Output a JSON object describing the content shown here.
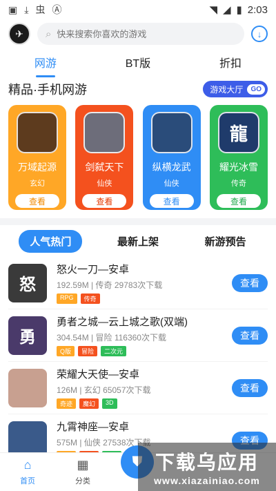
{
  "status": {
    "time": "2:03",
    "left_icons": [
      "image-icon",
      "download-arrow-icon",
      "app-icon",
      "a-icon"
    ]
  },
  "header": {
    "search_placeholder": "快来搜索你喜欢的游戏"
  },
  "tabs": [
    {
      "label": "网游",
      "active": true
    },
    {
      "label": "BT版",
      "active": false
    },
    {
      "label": "折扣",
      "active": false
    }
  ],
  "featured": {
    "title": "精品·手机网游",
    "hall_button": "游戏大厅",
    "hall_go": "GO",
    "cards": [
      {
        "name": "万域起源",
        "genre": "玄幻",
        "button": "查看",
        "bg": "#ffa726",
        "img": "#5d3b1e",
        "img_text": "",
        "btn_color": "#f08a00"
      },
      {
        "name": "剑弑天下",
        "genre": "仙侠",
        "button": "查看",
        "bg": "#f4511e",
        "img": "#6d6d7a",
        "img_text": "",
        "btn_color": "#e53900"
      },
      {
        "name": "纵横龙武",
        "genre": "仙侠",
        "button": "查看",
        "bg": "#2f8df5",
        "img": "#2a4c7a",
        "img_text": "",
        "btn_color": "#2f8df5"
      },
      {
        "name": "耀光冰雪",
        "genre": "传奇",
        "button": "查看",
        "bg": "#2ebd59",
        "img": "#1f3b6b",
        "img_text": "龍",
        "btn_color": "#1ea84a"
      }
    ]
  },
  "subtabs": [
    {
      "label": "人气热门",
      "active": true
    },
    {
      "label": "最新上架",
      "active": false
    },
    {
      "label": "新游预告",
      "active": false
    }
  ],
  "games": [
    {
      "name": "怒火一刀—安卓",
      "meta": "192.59M | 传奇   29783次下载",
      "img": "#3a3a3a",
      "img_text": "怒",
      "button": "查看",
      "tags": [
        {
          "label": "RPG",
          "color": "#ffa726"
        },
        {
          "label": "传奇",
          "color": "#f4511e"
        }
      ]
    },
    {
      "name": "勇者之城—云上城之歌(双端)",
      "meta": "304.54M | 冒险   116360次下载",
      "img": "#4a3a6a",
      "img_text": "勇",
      "button": "查看",
      "tags": [
        {
          "label": "Q版",
          "color": "#ffa726"
        },
        {
          "label": "冒险",
          "color": "#f4511e"
        },
        {
          "label": "二次元",
          "color": "#2ebd59"
        }
      ]
    },
    {
      "name": "荣耀大天使—安卓",
      "meta": "126M | 玄幻   65057次下载",
      "img": "#c8a090",
      "img_text": "",
      "button": "查看",
      "tags": [
        {
          "label": "奇迹",
          "color": "#ffa726"
        },
        {
          "label": "魔幻",
          "color": "#f4511e"
        },
        {
          "label": "3D",
          "color": "#2ebd59"
        }
      ]
    },
    {
      "name": "九霄神座—安卓",
      "meta": "575M | 仙侠   27538次下载",
      "img": "#3a5a8a",
      "img_text": "",
      "button": "查看",
      "tags": [
        {
          "label": "仙侠",
          "color": "#ffa726"
        },
        {
          "label": "热游",
          "color": "#f4511e"
        },
        {
          "label": "新服",
          "color": "#2ebd59"
        }
      ]
    }
  ],
  "bottom_nav": [
    {
      "label": "首页",
      "icon": "home-icon",
      "active": true
    },
    {
      "label": "分类",
      "icon": "grid-icon",
      "active": false
    }
  ],
  "watermark": {
    "title": "下载乌应用",
    "url": "www.xiazainiao.com"
  }
}
